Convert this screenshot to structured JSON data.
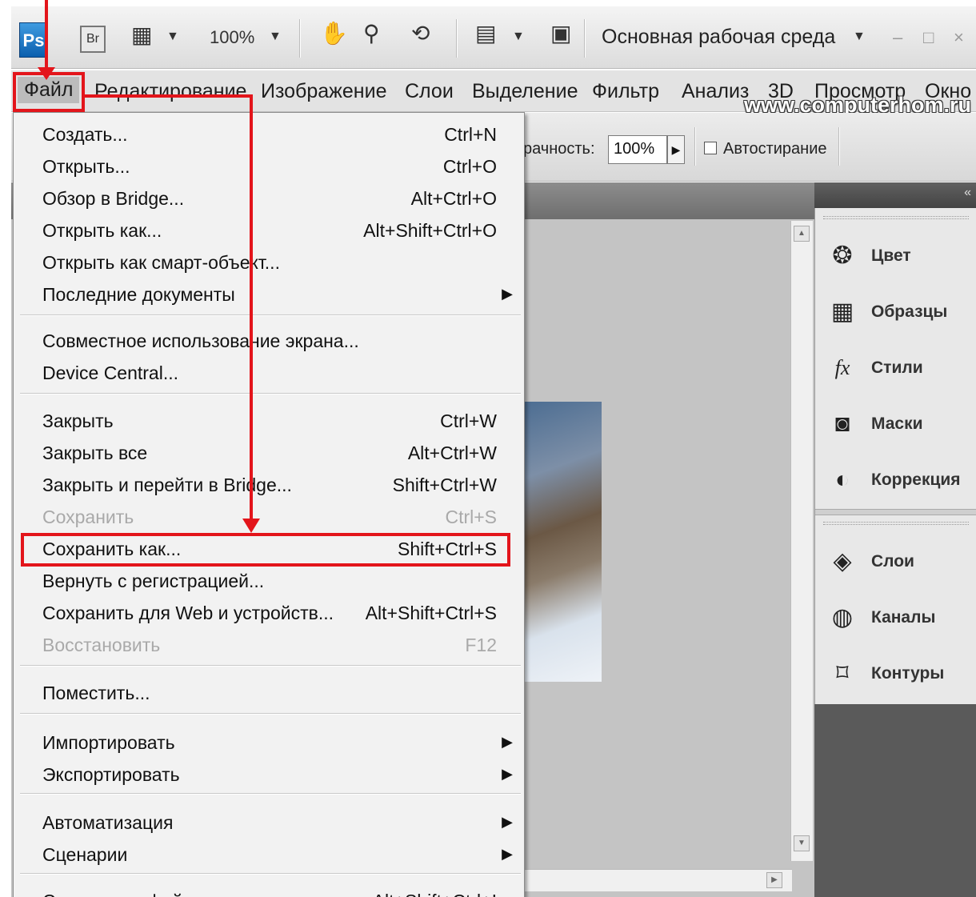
{
  "app": {
    "ps_logo": "Ps",
    "br_logo": "Br",
    "zoom": "100%",
    "workspace": "Основная рабочая среда",
    "minimize": "–",
    "maximize": "□",
    "close": "×"
  },
  "menubar": [
    {
      "label": "Файл"
    },
    {
      "label": "Редактирование"
    },
    {
      "label": "Изображение"
    },
    {
      "label": "Слои"
    },
    {
      "label": "Выделение"
    },
    {
      "label": "Фильтр"
    },
    {
      "label": "Анализ"
    },
    {
      "label": "3D"
    },
    {
      "label": "Просмотр"
    },
    {
      "label": "Окно"
    }
  ],
  "watermark": "www.computerhom.ru",
  "options": {
    "opacity_label": "рачность:",
    "opacity_value": "100%",
    "autoerase_label": "Автостирание"
  },
  "file_menu": [
    {
      "label": "Создать...",
      "shortcut": "Ctrl+N"
    },
    {
      "label": "Открыть...",
      "shortcut": "Ctrl+O"
    },
    {
      "label": "Обзор в Bridge...",
      "shortcut": "Alt+Ctrl+O"
    },
    {
      "label": "Открыть как...",
      "shortcut": "Alt+Shift+Ctrl+O"
    },
    {
      "label": "Открыть как смарт-объект...",
      "shortcut": ""
    },
    {
      "label": "Последние документы",
      "shortcut": ""
    },
    {
      "label": "Совместное использование экрана...",
      "shortcut": ""
    },
    {
      "label": "Device Central...",
      "shortcut": ""
    },
    {
      "label": "Закрыть",
      "shortcut": "Ctrl+W"
    },
    {
      "label": "Закрыть все",
      "shortcut": "Alt+Ctrl+W"
    },
    {
      "label": "Закрыть и перейти в Bridge...",
      "shortcut": "Shift+Ctrl+W"
    },
    {
      "label": "Сохранить",
      "shortcut": "Ctrl+S"
    },
    {
      "label": "Сохранить как...",
      "shortcut": "Shift+Ctrl+S"
    },
    {
      "label": "Вернуть с регистрацией...",
      "shortcut": ""
    },
    {
      "label": "Сохранить для Web и устройств...",
      "shortcut": "Alt+Shift+Ctrl+S"
    },
    {
      "label": "Восстановить",
      "shortcut": "F12"
    },
    {
      "label": "Поместить...",
      "shortcut": ""
    },
    {
      "label": "Импортировать",
      "shortcut": ""
    },
    {
      "label": "Экспортировать",
      "shortcut": ""
    },
    {
      "label": "Автоматизация",
      "shortcut": ""
    },
    {
      "label": "Сценарии",
      "shortcut": ""
    },
    {
      "label": "Сведения о файле...",
      "shortcut": "Alt+Shift+Ctrl+I"
    }
  ],
  "panels": [
    {
      "label": "Цвет",
      "icon": "color-icon"
    },
    {
      "label": "Образцы",
      "icon": "swatches-icon"
    },
    {
      "label": "Стили",
      "icon": "styles-icon"
    },
    {
      "label": "Маски",
      "icon": "masks-icon"
    },
    {
      "label": "Коррекция",
      "icon": "adjustments-icon"
    },
    {
      "label": "Слои",
      "icon": "layers-icon"
    },
    {
      "label": "Каналы",
      "icon": "channels-icon"
    },
    {
      "label": "Контуры",
      "icon": "paths-icon"
    }
  ],
  "colors": {
    "annotation_red": "#e3151b",
    "menu_bg": "#f2f2f2",
    "disabled_text": "#a9a9a9"
  }
}
